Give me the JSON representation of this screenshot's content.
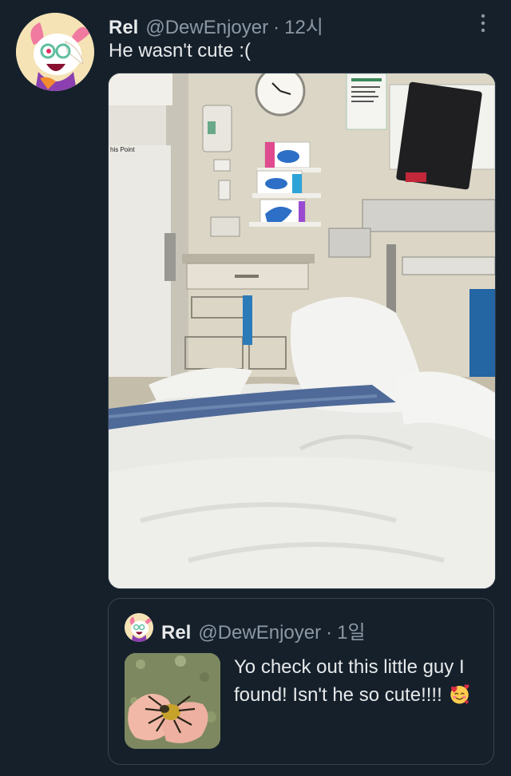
{
  "tweet": {
    "author": {
      "display_name": "Rel",
      "handle": "@DewEnjoyer",
      "avatar_icon": "goat-character-avatar-icon"
    },
    "separator": "·",
    "time": "12시",
    "text": "He wasn't cute :(",
    "more_icon": "more-vertical-icon",
    "media": {
      "kind": "photo",
      "clock_icon": "wall-clock-icon"
    }
  },
  "quoted_tweet": {
    "author": {
      "display_name": "Rel",
      "handle": "@DewEnjoyer",
      "avatar_icon": "goat-character-avatar-icon"
    },
    "separator": "·",
    "time": "1일",
    "text": "Yo check out this little guy I found! Isn't he so cute!!!!",
    "emoji_icon": "smiling-face-with-hearts-icon",
    "thumbnail": "spider-in-hands-photo"
  },
  "colors": {
    "background": "#15202b",
    "primary_text": "#e7e9ea",
    "secondary_text": "#8b98a5",
    "border": "#38444d"
  }
}
